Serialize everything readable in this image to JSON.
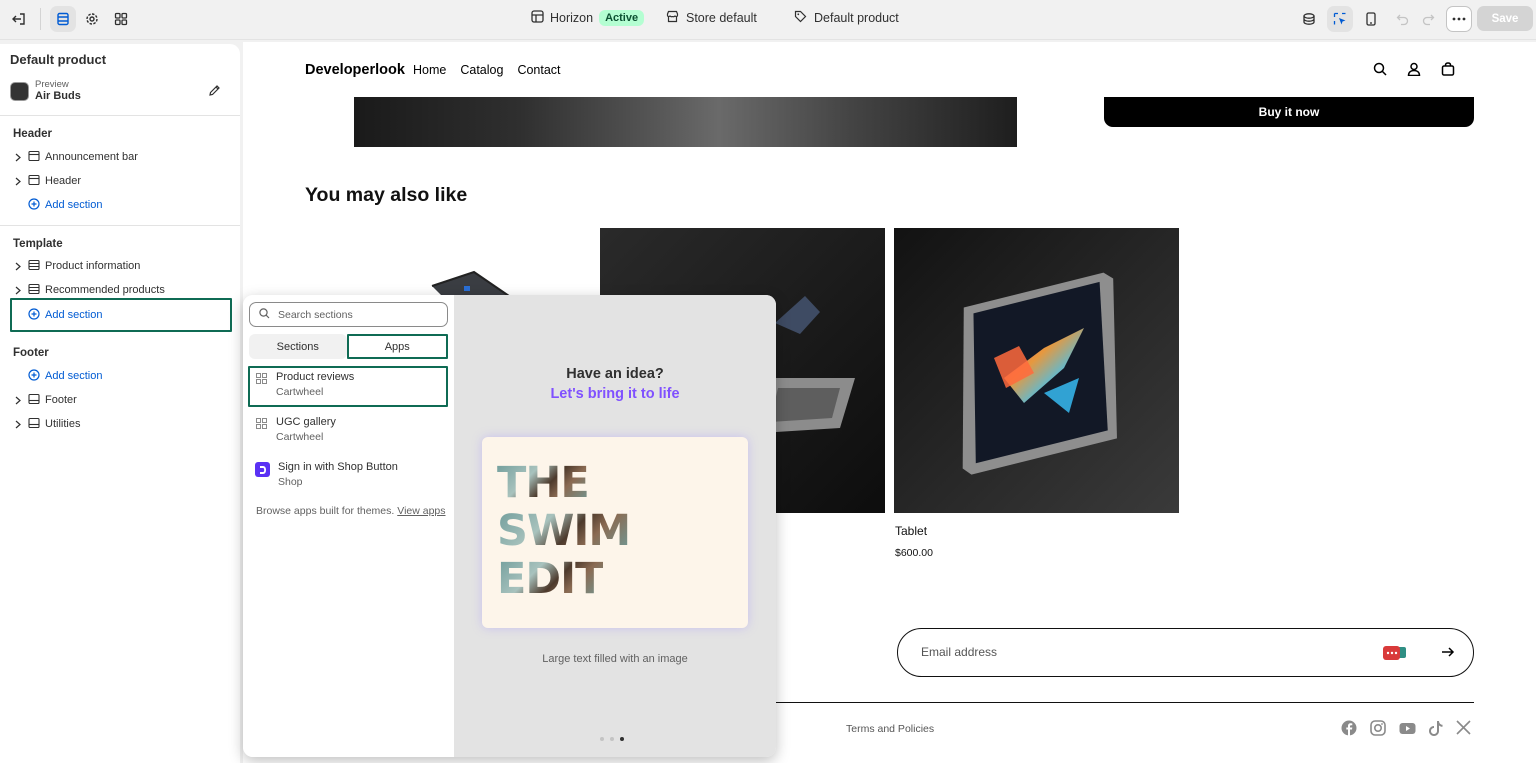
{
  "topbar": {
    "theme_name": "Horizon",
    "theme_status": "Active",
    "store_label": "Store default",
    "template_label": "Default product",
    "save_label": "Save"
  },
  "sidebar": {
    "title": "Default product",
    "preview_label": "Preview",
    "preview_value": "Air Buds",
    "groups": [
      {
        "label": "Header",
        "items": [
          "Announcement bar",
          "Header"
        ],
        "add_label": "Add section"
      },
      {
        "label": "Template",
        "items": [
          "Product information",
          "Recommended products"
        ],
        "add_label": "Add section"
      },
      {
        "label": "Footer",
        "items": [
          "Footer",
          "Utilities"
        ],
        "add_label": "Add section"
      }
    ]
  },
  "store": {
    "logo": "Developerlook",
    "nav": [
      "Home",
      "Catalog",
      "Contact"
    ],
    "buy_now": "Buy it now",
    "also_like": "You may also like",
    "products": [
      {
        "name": "Tablet",
        "price": "$600.00"
      }
    ],
    "email_placeholder": "Email address",
    "terms": "Terms and Policies"
  },
  "popover": {
    "search_placeholder": "Search sections",
    "tabs": [
      "Sections",
      "Apps"
    ],
    "selected_tab": "Apps",
    "apps": [
      {
        "title": "Product reviews",
        "subtitle": "Cartwheel"
      },
      {
        "title": "UGC gallery",
        "subtitle": "Cartwheel"
      },
      {
        "title": "Sign in with Shop Button",
        "subtitle": "Shop"
      }
    ],
    "browse_text": "Browse apps built for themes.",
    "browse_link": "View apps",
    "idea_title": "Have an idea?",
    "idea_sub": "Let's bring it to life",
    "swim_lines": [
      "THE",
      "SWIM",
      "EDIT"
    ],
    "caption": "Large text filled with an image",
    "slide_index": 3,
    "slide_count": 3
  },
  "colors": {
    "accent_blue": "#005bd3",
    "highlight_green": "#0f6b54",
    "purple": "#8051ff",
    "active_badge_bg": "#b4fed2"
  }
}
